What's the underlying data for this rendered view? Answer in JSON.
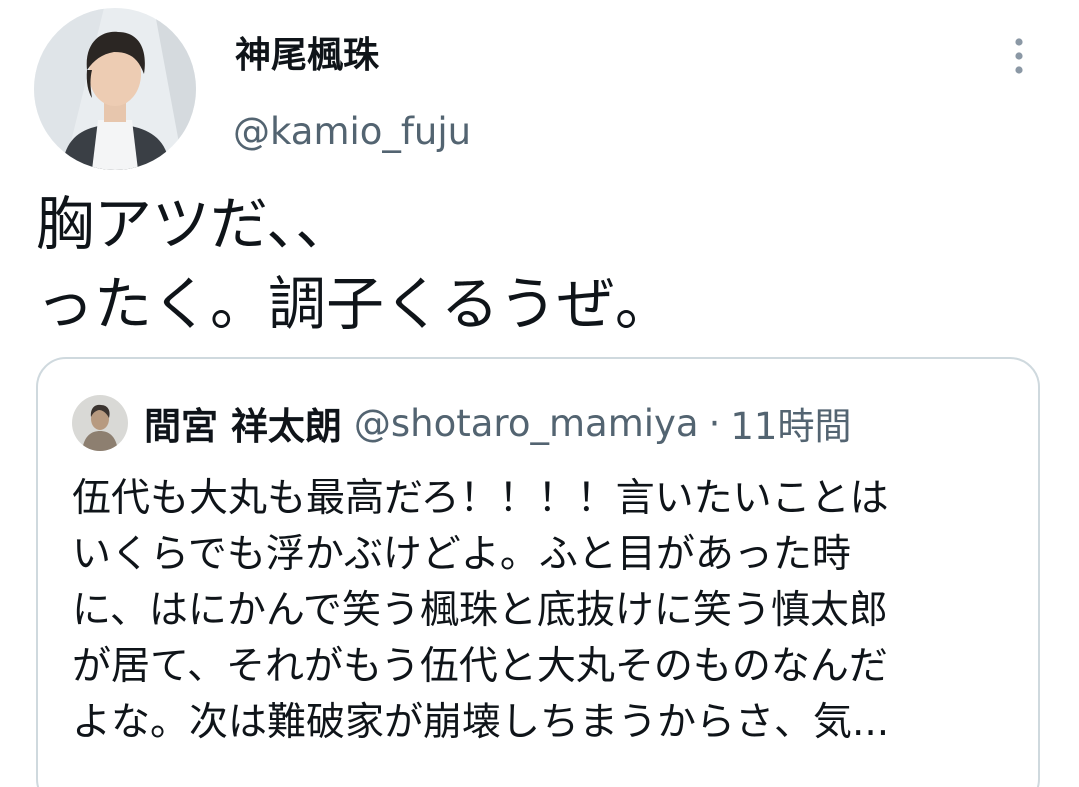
{
  "author": {
    "display_name": "神尾楓珠",
    "handle": "@kamio_fuju"
  },
  "tweet": {
    "lines": [
      "胸アツだ、、",
      "ったく。調子くるうぜ。"
    ]
  },
  "quoted": {
    "display_name": "間宮 祥太朗",
    "handle": "@shotaro_mamiya",
    "separator": "·",
    "time": "11時間",
    "lines": [
      "伍代も大丸も最高だろ！！！！言いたいことは",
      "いくらでも浮かぶけどよ。ふと目があった時",
      "に、はにかんで笑う楓珠と底抜けに笑う慎太郎",
      "が居て、それがもう伍代と大丸そのものなんだ",
      "よな。次は難破家が崩壊しちまうからさ、気..."
    ]
  },
  "icons": {
    "more": "more-vertical-icon"
  },
  "colors": {
    "text": "#0f1419",
    "secondary": "#536471",
    "border": "#cfd9de"
  }
}
